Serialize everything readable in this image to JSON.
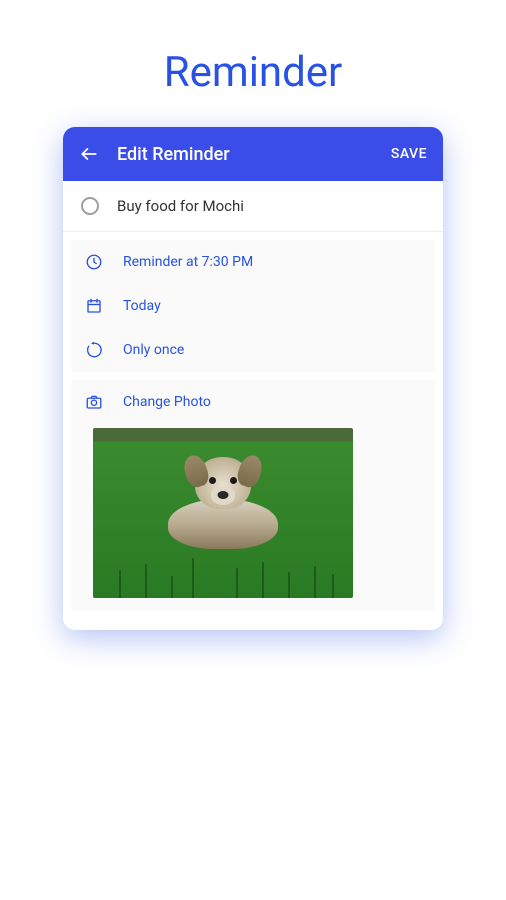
{
  "page_title": "Reminder",
  "header": {
    "title": "Edit Reminder",
    "save_label": "SAVE"
  },
  "task": {
    "title": "Buy food for Mochi",
    "completed": false
  },
  "settings": {
    "time_label": "Reminder at 7:30 PM",
    "date_label": "Today",
    "repeat_label": "Only once"
  },
  "photo": {
    "change_label": "Change Photo",
    "description": "Small terrier dog lying in green grass"
  },
  "colors": {
    "primary": "#3a4de8",
    "accent": "#2952e3"
  }
}
